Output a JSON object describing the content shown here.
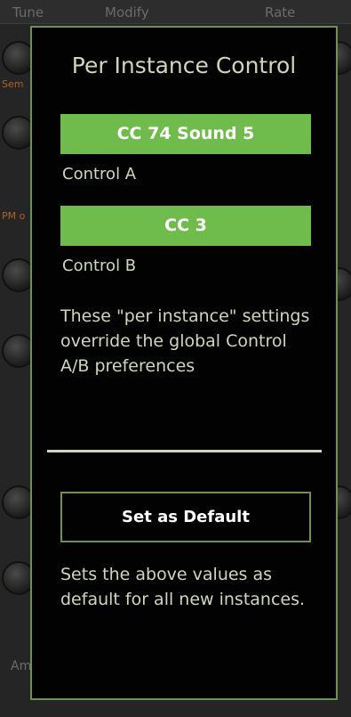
{
  "background": {
    "header": [
      "Tune",
      "Modify",
      "Rate"
    ],
    "side_labels": [
      "Sem",
      "PM o",
      "Am"
    ]
  },
  "panel": {
    "title": "Per Instance Control",
    "control_a": {
      "value": "CC 74 Sound 5",
      "label": "Control A"
    },
    "control_b": {
      "value": "CC 3",
      "label": "Control B"
    },
    "info_text": "These \"per instance\" settings override the global Control A/B preferences",
    "default_button_label": "Set as Default",
    "default_help_text": "Sets the above values as default for all new instances."
  },
  "colors": {
    "accent_green": "#6fbc4c",
    "border_green": "#6d8f58",
    "text": "#cdd7b9",
    "panel_bg": "#020202"
  }
}
